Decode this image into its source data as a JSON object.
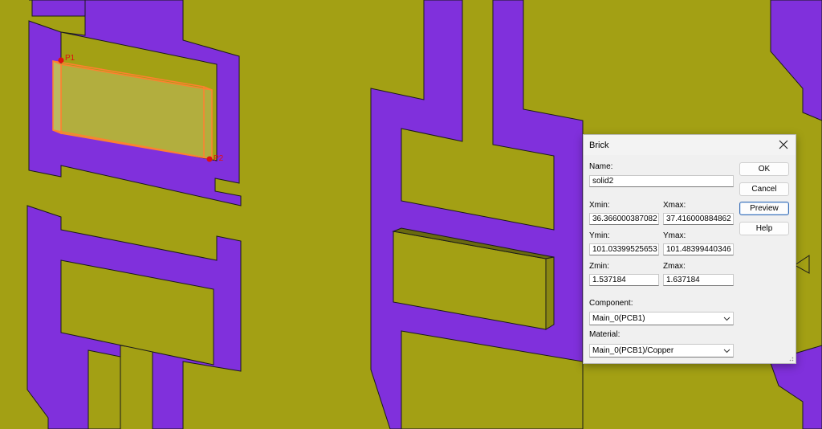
{
  "colors": {
    "background": "#a3a014",
    "trace": "#8030dc",
    "selection": "#ff8030",
    "point_marker": "#e01010"
  },
  "viewport": {
    "point_labels": [
      "P1",
      "P2"
    ]
  },
  "dialog": {
    "title": "Brick",
    "close_icon": "close-icon",
    "name_label": "Name:",
    "name_value": "solid2",
    "xmin_label": "Xmin:",
    "xmin_value": "36.366000387082",
    "xmax_label": "Xmax:",
    "xmax_value": "37.416000884862",
    "ymin_label": "Ymin:",
    "ymin_value": "101.03399525653",
    "ymax_label": "Ymax:",
    "ymax_value": "101.48399440346",
    "zmin_label": "Zmin:",
    "zmin_value": "1.537184",
    "zmax_label": "Zmax:",
    "zmax_value": "1.637184",
    "component_label": "Component:",
    "component_value": "Main_0(PCB1)",
    "material_label": "Material:",
    "material_value": "Main_0(PCB1)/Copper",
    "buttons": {
      "ok": "OK",
      "cancel": "Cancel",
      "preview": "Preview",
      "help": "Help"
    }
  }
}
